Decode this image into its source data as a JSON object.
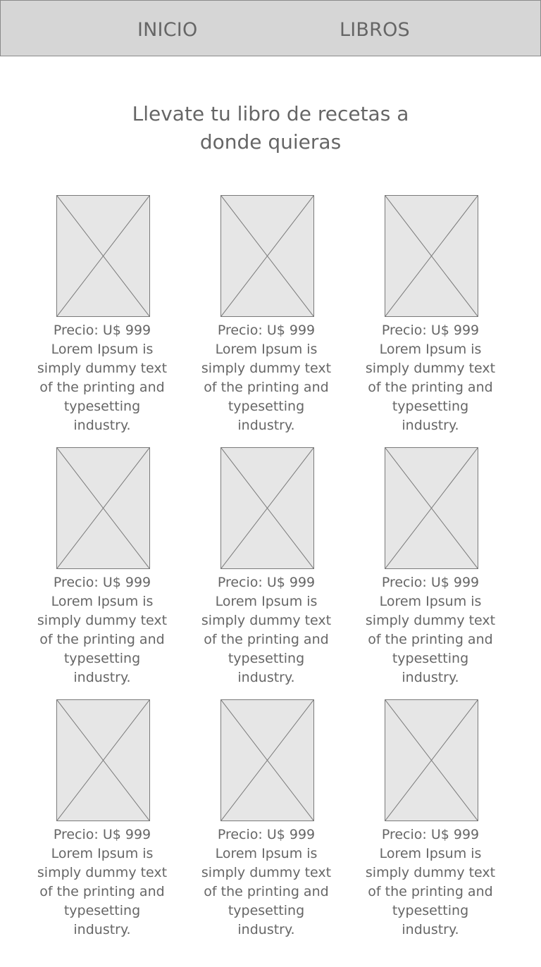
{
  "nav": {
    "items": [
      {
        "label": "INICIO"
      },
      {
        "label": "LIBROS"
      }
    ]
  },
  "hero": {
    "line1": "Llevate tu libro de recetas a",
    "line2": "donde quieras"
  },
  "books": [
    {
      "price": "Precio: U$ 999",
      "description": "Lorem Ipsum is simply dummy text of the printing and typesetting industry."
    },
    {
      "price": "Precio: U$ 999",
      "description": "Lorem Ipsum is simply dummy text of the printing and typesetting industry."
    },
    {
      "price": "Precio: U$ 999",
      "description": "Lorem Ipsum is simply dummy text of the printing and typesetting industry."
    },
    {
      "price": "Precio: U$ 999",
      "description": "Lorem Ipsum is simply dummy text of the printing and typesetting industry."
    },
    {
      "price": "Precio: U$ 999",
      "description": "Lorem Ipsum is simply dummy text of the printing and typesetting industry."
    },
    {
      "price": "Precio: U$ 999",
      "description": "Lorem Ipsum is simply dummy text of the printing and typesetting industry."
    },
    {
      "price": "Precio: U$ 999",
      "description": "Lorem Ipsum is simply dummy text of the printing and typesetting industry."
    },
    {
      "price": "Precio: U$ 999",
      "description": "Lorem Ipsum is simply dummy text of the printing and typesetting industry."
    },
    {
      "price": "Precio: U$ 999",
      "description": "Lorem Ipsum is simply dummy text of the printing and typesetting industry."
    }
  ],
  "colors": {
    "nav_background": "#d6d6d6",
    "placeholder_fill": "#e6e6e6",
    "text": "#666666"
  }
}
